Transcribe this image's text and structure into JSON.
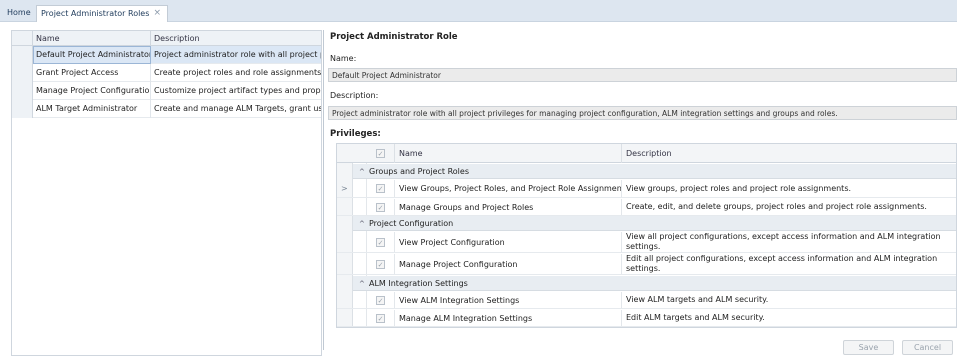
{
  "tabs": [
    {
      "label": "Home"
    },
    {
      "label": "Project Administrator Roles",
      "close": "×"
    }
  ],
  "roles_grid": {
    "columns": [
      "Name",
      "Description"
    ],
    "rows": [
      {
        "name": "Default Project Administrator",
        "description": "Project administrator role with all project privileges for managing project configuration, ALM integration settings and groups and roles.",
        "description_visible": "Project administrator role with all project p",
        "selected": true
      },
      {
        "name": "Grant Project Access",
        "description": "Create project roles and role assignments."
      },
      {
        "name": "Manage Project Configuration",
        "description": "Customize project artifact types and proper"
      },
      {
        "name": "ALM Target Administrator",
        "description": "Create and manage ALM Targets, grant use"
      }
    ]
  },
  "detail": {
    "title": "Project Administrator Role",
    "name_label": "Name:",
    "name_value": "Default Project Administrator",
    "description_label": "Description:",
    "description_value": "Project administrator role with all project privileges for managing project configuration, ALM integration settings and groups and roles.",
    "privileges_label": "Privileges:"
  },
  "privileges": {
    "columns": [
      "Name",
      "Description"
    ],
    "check": "✓",
    "groups": [
      {
        "label": "Groups and Project Roles",
        "items": [
          {
            "name": "View Groups, Project Roles, and Project Role Assignments",
            "description": "View groups, project roles and project role assignments.",
            "current": true
          },
          {
            "name": "Manage Groups and Project Roles",
            "description": "Create, edit, and delete groups, project roles and project role assignments."
          }
        ]
      },
      {
        "label": "Project Configuration",
        "items": [
          {
            "name": "View Project Configuration",
            "description": "View all project configurations, except access information and ALM integration settings."
          },
          {
            "name": "Manage Project Configuration",
            "description": "Edit all project configurations, except access information and ALM integration settings."
          }
        ]
      },
      {
        "label": "ALM Integration Settings",
        "items": [
          {
            "name": "View ALM Integration Settings",
            "description": "View ALM targets and ALM security."
          },
          {
            "name": "Manage ALM Integration Settings",
            "description": "Edit ALM targets and ALM security."
          }
        ]
      }
    ]
  },
  "buttons": {
    "save": "Save",
    "cancel": "Cancel"
  }
}
